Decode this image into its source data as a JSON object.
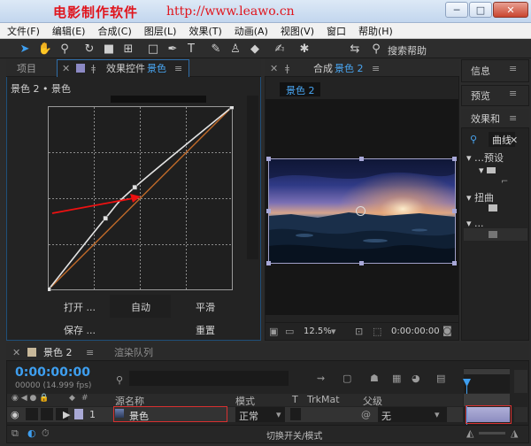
{
  "watermark": {
    "cn": "电影制作软件",
    "url": "http://www.leawo.cn"
  },
  "window": {
    "min": "─",
    "max": "□",
    "close": "✕"
  },
  "menu": [
    "文件(F)",
    "编辑(E)",
    "合成(C)",
    "图层(L)",
    "效果(T)",
    "动画(A)",
    "视图(V)",
    "窗口",
    "帮助(H)"
  ],
  "toolbar": {
    "search_label": "搜索帮助"
  },
  "left_panel": {
    "tab_project": "项目",
    "tab_effects_prefix": "效果控件",
    "tab_effects_layer": "景色",
    "breadcrumb": "景色 2 • 景色",
    "buttons": {
      "open": "打开 ...",
      "auto": "自动",
      "smooth": "平滑",
      "save": "保存 ...",
      "reset": "重置"
    }
  },
  "comp_panel": {
    "tab_prefix": "合成",
    "tab_name": "景色 2",
    "comp_tag": "景色 2",
    "zoom": "12.5%",
    "timecode": "0:00:00:00"
  },
  "right_panels": {
    "info": "信息",
    "preview": "预览",
    "effects_presets": "效果和",
    "search_value": "曲线",
    "tree": [
      {
        "label": "预设"
      },
      {
        "label": "扭曲"
      },
      {
        "label": "..."
      }
    ]
  },
  "timeline": {
    "tab_comp": "景色 2",
    "tab_render": "渲染队列",
    "timecode": "0:00:00:00",
    "fps": "00000 (14.999 fps)",
    "search_placeholder": "",
    "columns": {
      "source": "源名称",
      "mode": "模式",
      "t": "T",
      "trkmat": "TrkMat",
      "parent": "父级"
    },
    "layers": [
      {
        "index": "1",
        "name": "景色",
        "mode": "正常",
        "parent": "无"
      }
    ],
    "footer": "切换开关/模式"
  },
  "curve": {
    "points": [
      [
        0,
        0
      ],
      [
        0.31,
        0.39
      ],
      [
        0.47,
        0.56
      ],
      [
        1,
        1
      ]
    ]
  },
  "colors": {
    "accent": "#49a6f2",
    "watermark": "#e0141c",
    "diagonal": "#c06a2a",
    "arrow": "#e11"
  }
}
